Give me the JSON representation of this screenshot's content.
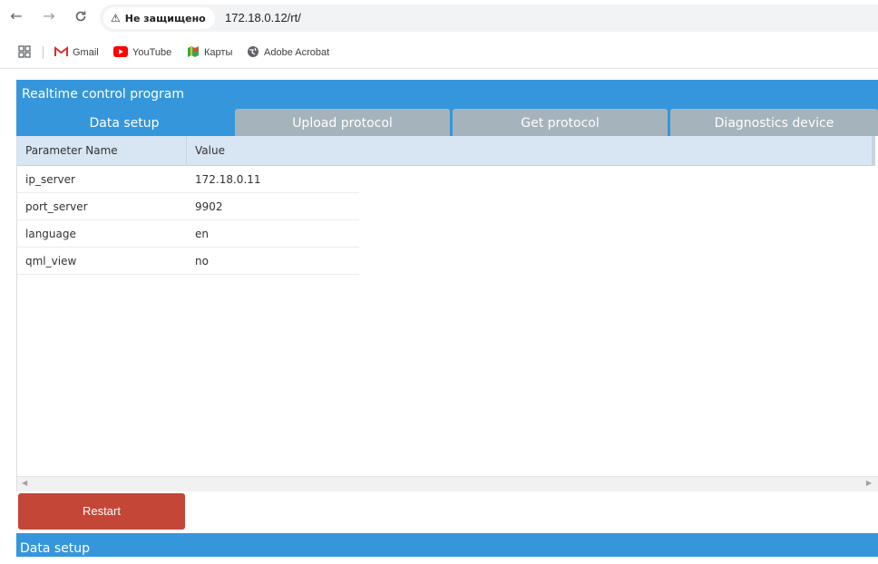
{
  "browser": {
    "security_label": "Не защищено",
    "url": "172.18.0.12/rt/",
    "bookmarks": [
      {
        "label": "Gmail",
        "icon": "gmail-icon"
      },
      {
        "label": "YouTube",
        "icon": "youtube-icon"
      },
      {
        "label": "Карты",
        "icon": "maps-icon"
      },
      {
        "label": "Adobe Acrobat",
        "icon": "globe-icon"
      }
    ]
  },
  "app": {
    "title": "Realtime control program",
    "tabs": [
      {
        "label": "Data setup",
        "active": true
      },
      {
        "label": "Upload protocol",
        "active": false
      },
      {
        "label": "Get protocol",
        "active": false
      },
      {
        "label": "Diagnostics device",
        "active": false
      }
    ],
    "table": {
      "columns": [
        "Parameter Name",
        "Value"
      ],
      "rows": [
        {
          "name": "ip_server",
          "value": "172.18.0.11"
        },
        {
          "name": "port_server",
          "value": "9902"
        },
        {
          "name": "language",
          "value": "en"
        },
        {
          "name": "qml_view",
          "value": "no"
        }
      ]
    },
    "restart_label": "Restart",
    "status": "Data setup"
  },
  "colors": {
    "accent": "#3596dc",
    "tab_inactive": "#a5b3bd",
    "danger": "#c44637",
    "grid_header": "#d8e5f2"
  }
}
